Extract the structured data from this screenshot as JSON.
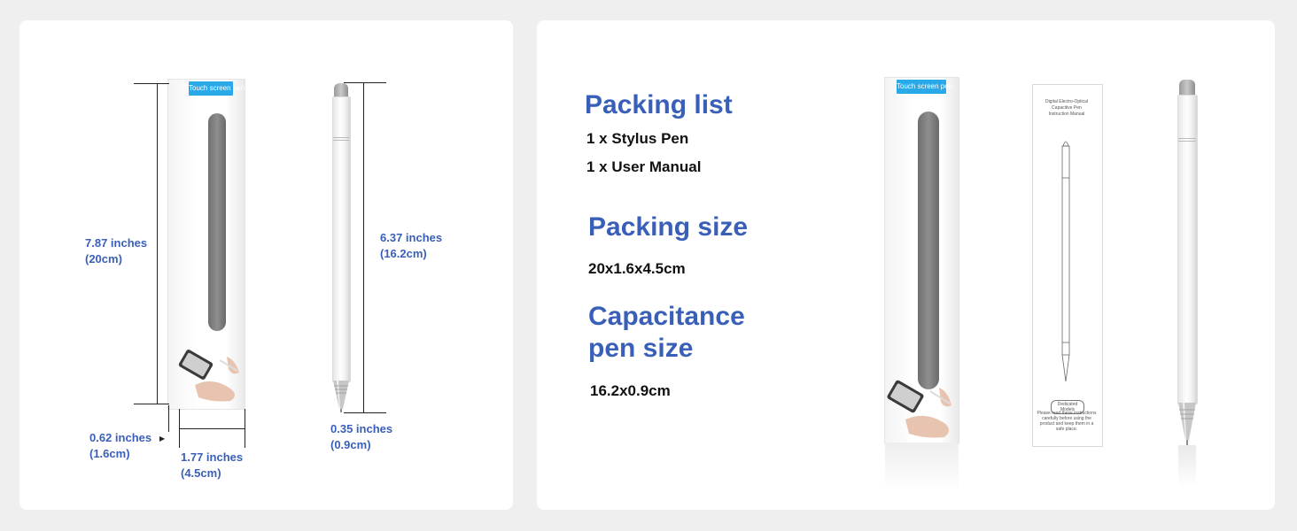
{
  "left": {
    "box_label": "Touch screen pen",
    "box_height": {
      "inches": "7.87 inches",
      "cm": "(20cm)"
    },
    "box_depth": {
      "inches": "0.62 inches",
      "cm": "(1.6cm)"
    },
    "box_width": {
      "inches": "1.77 inches",
      "cm": "(4.5cm)"
    },
    "pen_length": {
      "inches": "6.37 inches",
      "cm": "(16.2cm)"
    },
    "pen_diameter": {
      "inches": "0.35 inches",
      "cm": "(0.9cm)"
    }
  },
  "right": {
    "packing_list": {
      "title": "Packing list",
      "items": [
        "1 x Stylus Pen",
        "1 x User Manual"
      ]
    },
    "packing_size": {
      "title": "Packing size",
      "value": "20x1.6x4.5cm"
    },
    "pen_size": {
      "title_line1": "Capacitance",
      "title_line2": "pen size",
      "value": "16.2x0.9cm"
    },
    "box_label": "Touch screen pen",
    "manual": {
      "title_lines": [
        "Digital Electro-Optical",
        "Capacitive Pen",
        "Instruction Manual"
      ],
      "badge": "Dedicated Models",
      "note": "Please read these instructions carefully before using the product and keep them in a safe place."
    }
  },
  "colors": {
    "accent": "#3a5fb8",
    "label_blue": "#29a9e8",
    "background": "#efefef"
  }
}
